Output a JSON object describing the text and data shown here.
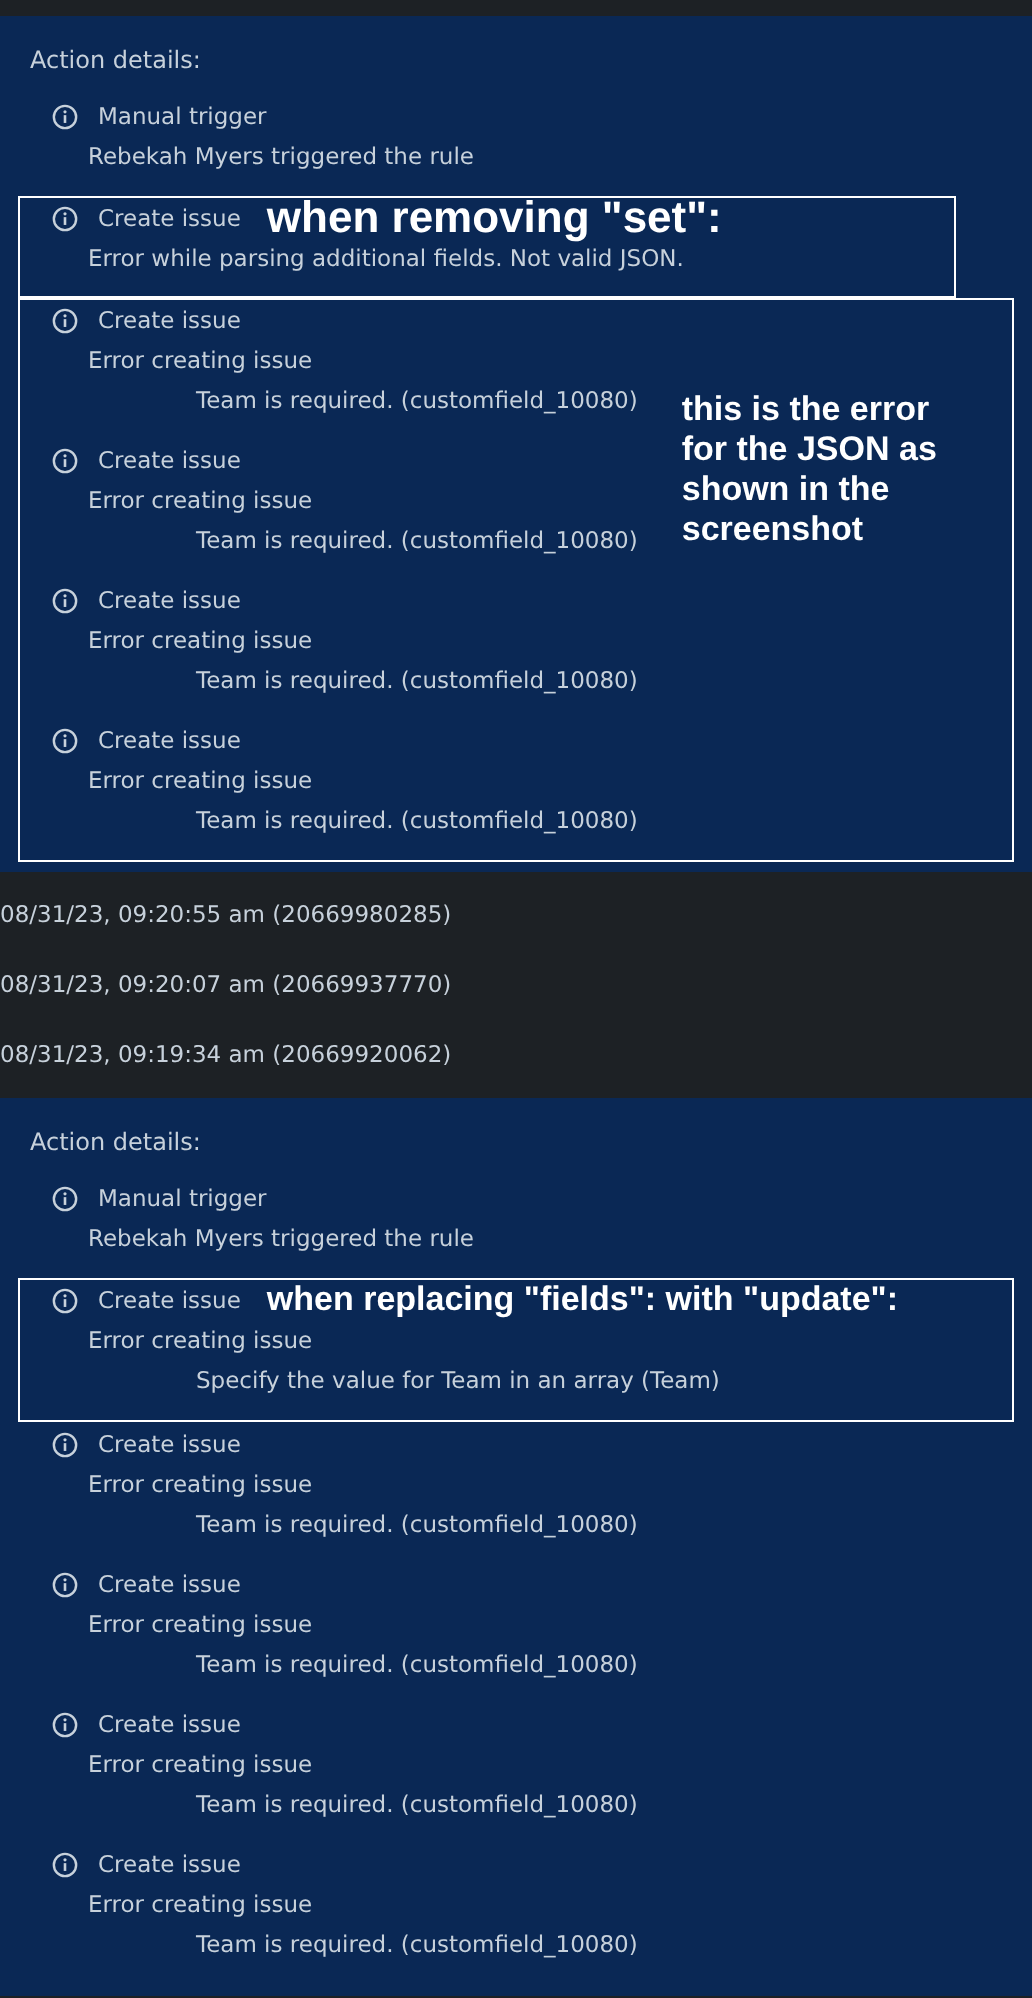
{
  "panels": [
    {
      "heading": "Action details:",
      "groups": [
        {
          "entries": [
            {
              "title": "Manual trigger",
              "message": "Rebekah Myers triggered the rule"
            }
          ]
        },
        {
          "annotation": {
            "kind": "headline",
            "note": "when removing \"set\":"
          },
          "entries": [
            {
              "title": "Create issue",
              "message": "Error while parsing additional fields. Not valid JSON."
            }
          ]
        },
        {
          "annotation": {
            "kind": "side",
            "note": "this is the error for the JSON as shown in the screenshot"
          },
          "entries": [
            {
              "title": "Create issue",
              "message": "Error creating issue",
              "detail": "Team is required. (customfield_10080)"
            },
            {
              "title": "Create issue",
              "message": "Error creating issue",
              "detail": "Team is required. (customfield_10080)"
            },
            {
              "title": "Create issue",
              "message": "Error creating issue",
              "detail": "Team is required. (customfield_10080)"
            },
            {
              "title": "Create issue",
              "message": "Error creating issue",
              "detail": "Team is required. (customfield_10080)"
            }
          ]
        }
      ]
    },
    {
      "runs": [
        "08/31/23, 09:20:55 am (20669980285)",
        "08/31/23, 09:20:07 am (20669937770)",
        "08/31/23, 09:19:34 am (20669920062)"
      ]
    },
    {
      "heading": "Action details:",
      "groups": [
        {
          "entries": [
            {
              "title": "Manual trigger",
              "message": "Rebekah Myers triggered the rule"
            }
          ]
        },
        {
          "annotation": {
            "kind": "inline",
            "note": "when replacing \"fields\": with \"update\":"
          },
          "entries": [
            {
              "title": "Create issue",
              "message": "Error creating issue",
              "detail": "Specify the value for Team in an array (Team)"
            }
          ]
        },
        {
          "entries": [
            {
              "title": "Create issue",
              "message": "Error creating issue",
              "detail": "Team is required. (customfield_10080)"
            },
            {
              "title": "Create issue",
              "message": "Error creating issue",
              "detail": "Team is required. (customfield_10080)"
            },
            {
              "title": "Create issue",
              "message": "Error creating issue",
              "detail": "Team is required. (customfield_10080)"
            },
            {
              "title": "Create issue",
              "message": "Error creating issue",
              "detail": "Team is required. (customfield_10080)"
            }
          ]
        }
      ]
    }
  ]
}
